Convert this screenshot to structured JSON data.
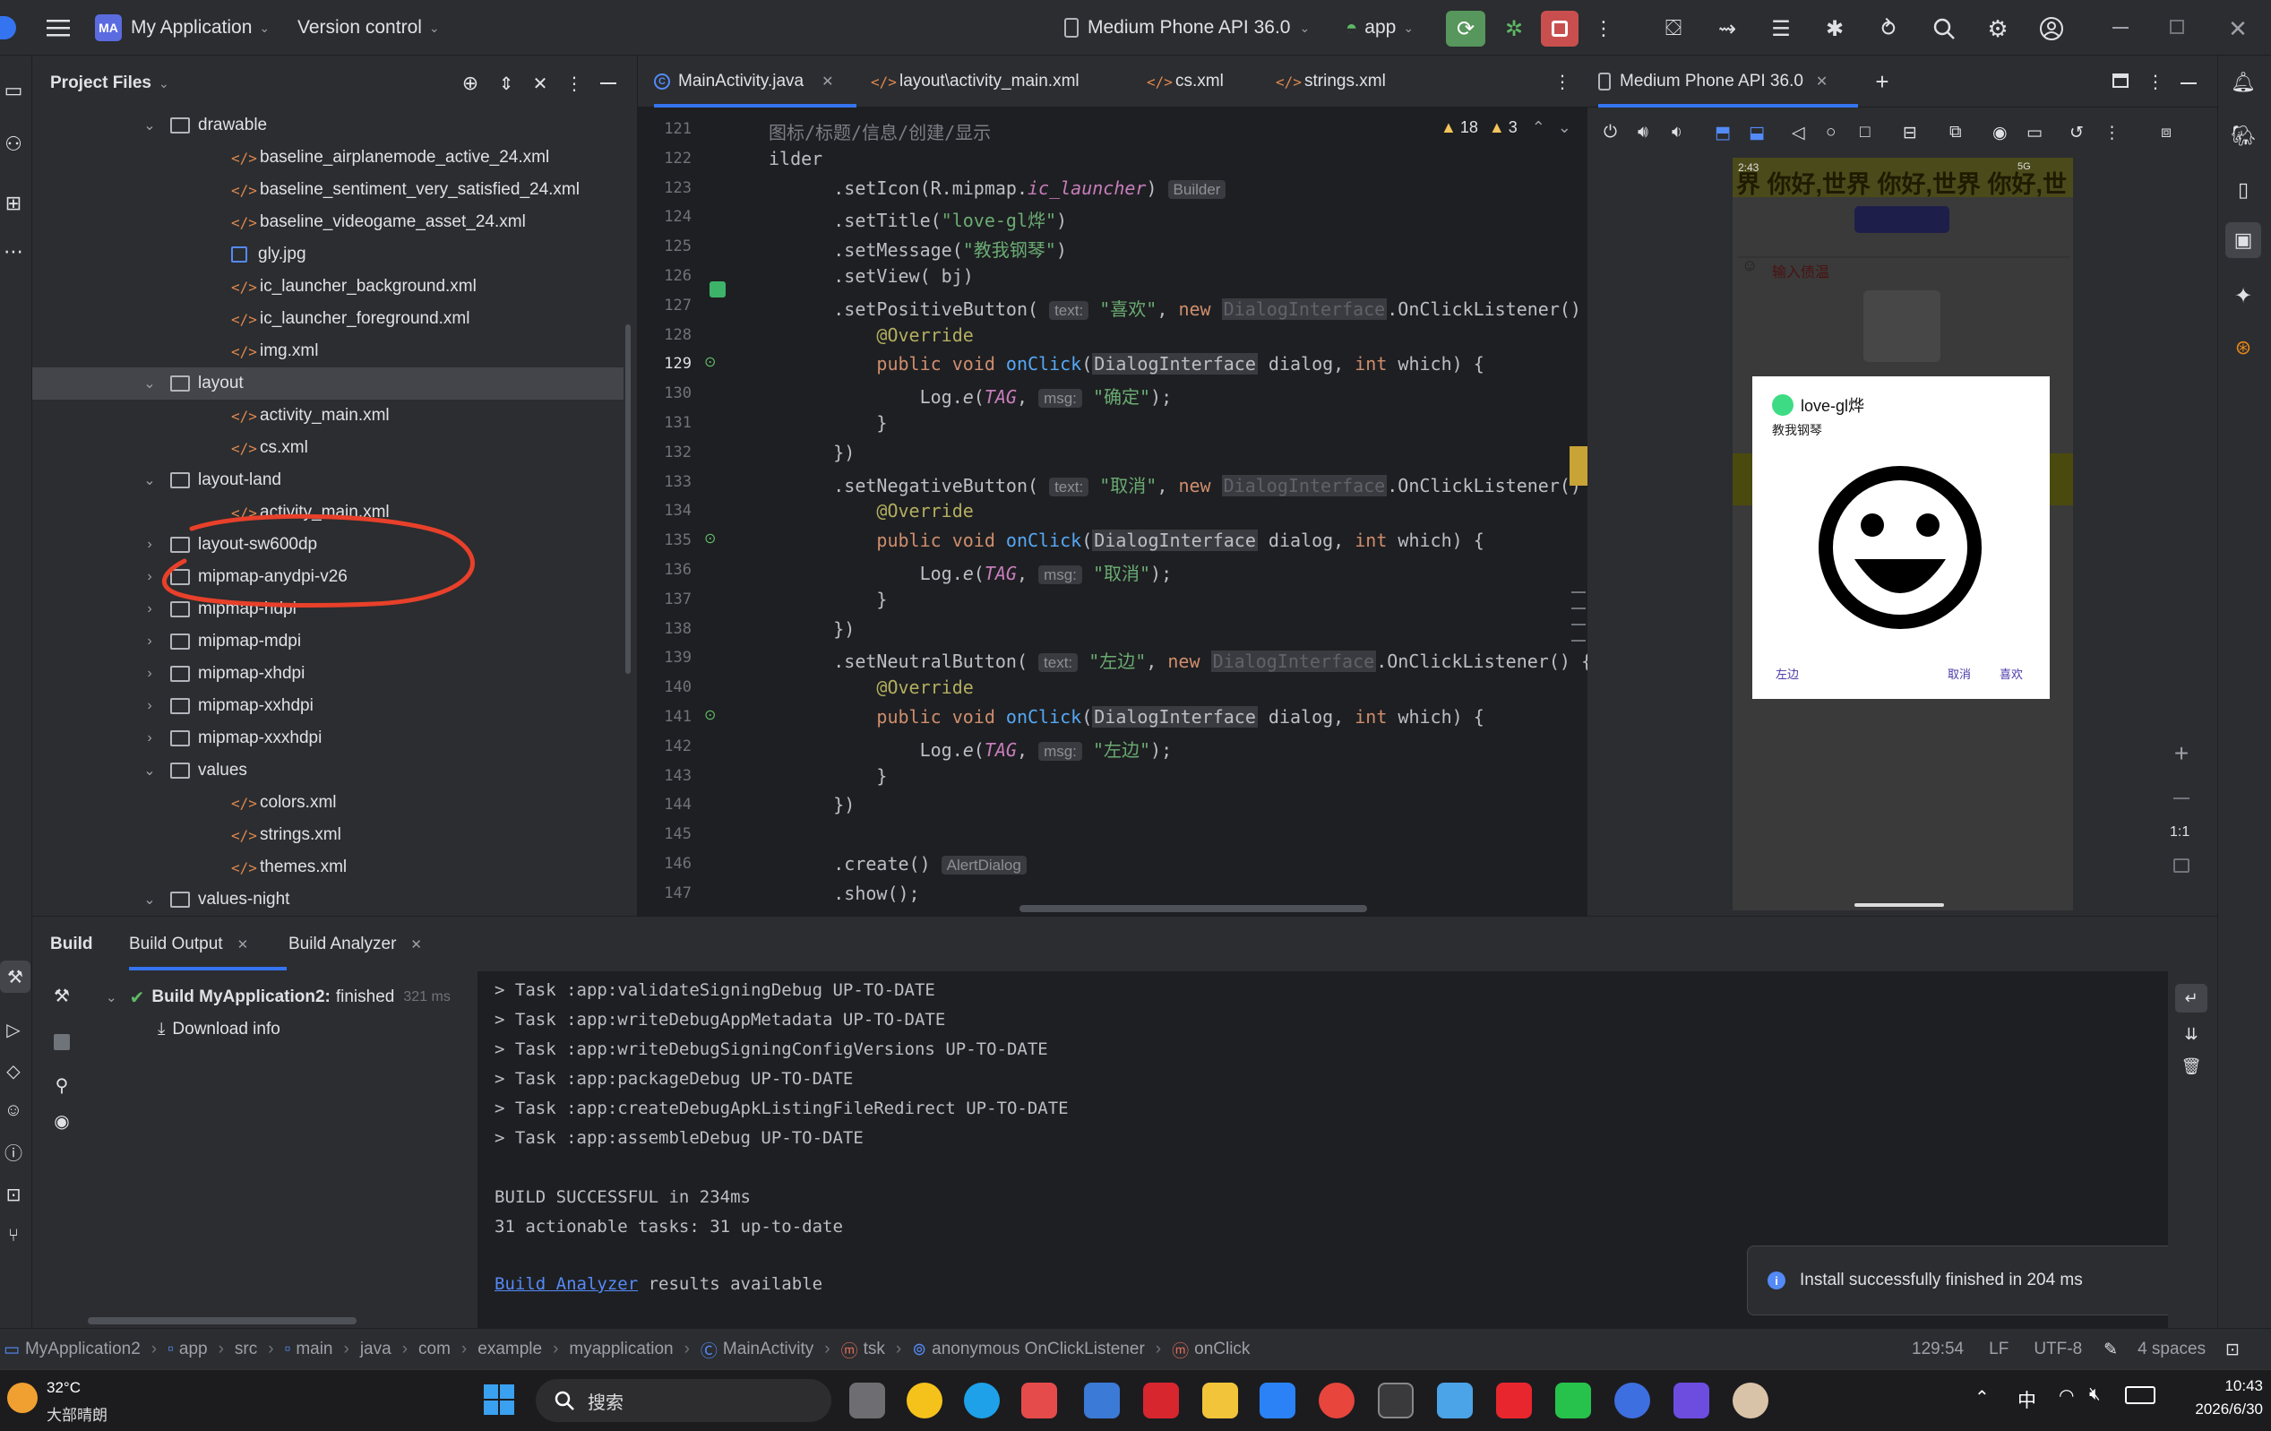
{
  "topbar": {
    "logo_badge": "MA",
    "project": "My Application",
    "vcs": "Version control",
    "device": "Medium Phone API 36.0",
    "run_config": "app"
  },
  "project_panel": {
    "title": "Project Files",
    "items": [
      {
        "type": "folder",
        "label": "drawable",
        "indent": 1,
        "expanded": true
      },
      {
        "type": "xml",
        "label": "baseline_airplanemode_active_24.xml",
        "indent": 2
      },
      {
        "type": "xml",
        "label": "baseline_sentiment_very_satisfied_24.xml",
        "indent": 2
      },
      {
        "type": "xml",
        "label": "baseline_videogame_asset_24.xml",
        "indent": 2
      },
      {
        "type": "img",
        "label": "gly.jpg",
        "indent": 2
      },
      {
        "type": "xml",
        "label": "ic_launcher_background.xml",
        "indent": 2
      },
      {
        "type": "xml",
        "label": "ic_launcher_foreground.xml",
        "indent": 2
      },
      {
        "type": "xml",
        "label": "img.xml",
        "indent": 2
      },
      {
        "type": "folder",
        "label": "layout",
        "indent": 1,
        "expanded": true,
        "selected": true
      },
      {
        "type": "xml",
        "label": "activity_main.xml",
        "indent": 2
      },
      {
        "type": "xml",
        "label": "cs.xml",
        "indent": 2
      },
      {
        "type": "folder",
        "label": "layout-land",
        "indent": 1,
        "expanded": true
      },
      {
        "type": "xml",
        "label": "activity_main.xml",
        "indent": 2
      },
      {
        "type": "folder",
        "label": "layout-sw600dp",
        "indent": 1,
        "expanded": false
      },
      {
        "type": "folder",
        "label": "mipmap-anydpi-v26",
        "indent": 1,
        "expanded": false
      },
      {
        "type": "folder",
        "label": "mipmap-hdpi",
        "indent": 1,
        "expanded": false
      },
      {
        "type": "folder",
        "label": "mipmap-mdpi",
        "indent": 1,
        "expanded": false
      },
      {
        "type": "folder",
        "label": "mipmap-xhdpi",
        "indent": 1,
        "expanded": false
      },
      {
        "type": "folder",
        "label": "mipmap-xxhdpi",
        "indent": 1,
        "expanded": false
      },
      {
        "type": "folder",
        "label": "mipmap-xxxhdpi",
        "indent": 1,
        "expanded": false
      },
      {
        "type": "folder",
        "label": "values",
        "indent": 1,
        "expanded": true
      },
      {
        "type": "xml",
        "label": "colors.xml",
        "indent": 2
      },
      {
        "type": "xml",
        "label": "strings.xml",
        "indent": 2
      },
      {
        "type": "xml",
        "label": "themes.xml",
        "indent": 2
      },
      {
        "type": "folder",
        "label": "values-night",
        "indent": 1,
        "expanded": true
      }
    ]
  },
  "editor": {
    "tabs": [
      {
        "label": "MainActivity.java",
        "active": true,
        "icon": "java-class-icon"
      },
      {
        "label": "layout\\activity_main.xml",
        "icon": "xml-icon"
      },
      {
        "label": "cs.xml",
        "icon": "xml-icon"
      },
      {
        "label": "strings.xml",
        "icon": "xml-icon"
      }
    ],
    "warnings": "18",
    "weak_warnings": "3",
    "lines": [
      {
        "n": "121",
        "html": "<span class='cmt'>图标/标题/信息/创建/显示</span>"
      },
      {
        "n": "122",
        "html": "ilder"
      },
      {
        "n": "123",
        "html": "      .setIcon(R.mipmap.<span class='it'>ic_launcher</span>) <span class='hint'>Builder</span>"
      },
      {
        "n": "124",
        "html": "      .setTitle(<span class='str'>\"love-gl烨\"</span>)"
      },
      {
        "n": "125",
        "html": "      .setMessage(<span class='str'>\"教我钢琴\"</span>)"
      },
      {
        "n": "126",
        "html": "      .setView( bj)"
      },
      {
        "n": "127",
        "html": "      .setPositiveButton( <span class='hint'>text:</span> <span class='str'>\"喜欢\"</span>, <span class='kw'>new</span> <span class='dim'>DialogInterface</span>.OnClickListener() {"
      },
      {
        "n": "128",
        "html": "          <span class='ann'>@Override</span>"
      },
      {
        "n": "129",
        "html": "          <span class='kw'>public void</span> <span class='fn'>onClick</span>(<span class='dim' style='color:#bcbec4'>DialogInterface</span> dialog, <span class='kw'>int</span> which) {"
      },
      {
        "n": "130",
        "html": "              Log.<span style='font-style:italic'>e</span>(<span class='it'>TAG</span>, <span class='hint'>msg:</span> <span class='str'>\"确定\"</span>);"
      },
      {
        "n": "131",
        "html": "          }"
      },
      {
        "n": "132",
        "html": "      })"
      },
      {
        "n": "133",
        "html": "      .setNegativeButton( <span class='hint'>text:</span> <span class='str'>\"取消\"</span>, <span class='kw'>new</span> <span class='dim'>DialogInterface</span>.OnClickListener() {"
      },
      {
        "n": "134",
        "html": "          <span class='ann'>@Override</span>"
      },
      {
        "n": "135",
        "html": "          <span class='kw'>public void</span> <span class='fn'>onClick</span>(<span class='dim' style='color:#bcbec4'>DialogInterface</span> dialog, <span class='kw'>int</span> which) {"
      },
      {
        "n": "136",
        "html": "              Log.<span style='font-style:italic'>e</span>(<span class='it'>TAG</span>, <span class='hint'>msg:</span> <span class='str'>\"取消\"</span>);"
      },
      {
        "n": "137",
        "html": "          }"
      },
      {
        "n": "138",
        "html": "      })"
      },
      {
        "n": "139",
        "html": "      .setNeutralButton( <span class='hint'>text:</span> <span class='str'>\"左边\"</span>, <span class='kw'>new</span> <span class='dim'>DialogInterface</span>.OnClickListener() {"
      },
      {
        "n": "140",
        "html": "          <span class='ann'>@Override</span>"
      },
      {
        "n": "141",
        "html": "          <span class='kw'>public void</span> <span class='fn'>onClick</span>(<span class='dim' style='color:#bcbec4'>DialogInterface</span> dialog, <span class='kw'>int</span> which) {"
      },
      {
        "n": "142",
        "html": "              Log.<span style='font-style:italic'>e</span>(<span class='it'>TAG</span>, <span class='hint'>msg:</span> <span class='str'>\"左边\"</span>);"
      },
      {
        "n": "143",
        "html": "          }"
      },
      {
        "n": "144",
        "html": "      })"
      },
      {
        "n": "145",
        "html": ""
      },
      {
        "n": "146",
        "html": "      .create() <span class='hint'>AlertDialog</span>"
      },
      {
        "n": "147",
        "html": "      .show();"
      }
    ]
  },
  "emulator": {
    "tab_title": "Medium Phone API 36.0",
    "status_time": "2:43",
    "status_net": "5G",
    "banner": "界 你好,世界 你好,世界 你好,世",
    "hint_text": "输入债温",
    "dialog": {
      "title": "love-gl烨",
      "message": "教我钢琴",
      "neutral": "左边",
      "negative": "取消",
      "positive": "喜欢"
    },
    "zoom_label": "1:1"
  },
  "build": {
    "tabs": [
      "Build",
      "Build Output",
      "Build Analyzer"
    ],
    "tree": {
      "title": "Build MyApplication2:",
      "status": "finished",
      "time": "321 ms",
      "download": "Download info"
    },
    "output": [
      "> Task :app:validateSigningDebug UP-TO-DATE",
      "> Task :app:writeDebugAppMetadata UP-TO-DATE",
      "> Task :app:writeDebugSigningConfigVersions UP-TO-DATE",
      "> Task :app:packageDebug UP-TO-DATE",
      "> Task :app:createDebugApkListingFileRedirect UP-TO-DATE",
      "> Task :app:assembleDebug UP-TO-DATE",
      "",
      "BUILD SUCCESSFUL in 234ms",
      "31 actionable tasks: 31 up-to-date"
    ],
    "analyzer_link": "Build Analyzer",
    "analyzer_suffix": " results available",
    "notification": "Install successfully finished in 204 ms"
  },
  "statusbar": {
    "breadcrumbs": [
      "MyApplication2",
      "app",
      "src",
      "main",
      "java",
      "com",
      "example",
      "myapplication",
      "MainActivity",
      "tsk",
      "anonymous OnClickListener",
      "onClick"
    ],
    "position": "129:54",
    "line_sep": "LF",
    "encoding": "UTF-8",
    "indent": "4 spaces"
  },
  "taskbar": {
    "weather_temp": "32°C",
    "weather_desc": "大部晴朗",
    "search": "搜索",
    "ime": "中",
    "time": "10:43",
    "date": "2026/6/30"
  }
}
